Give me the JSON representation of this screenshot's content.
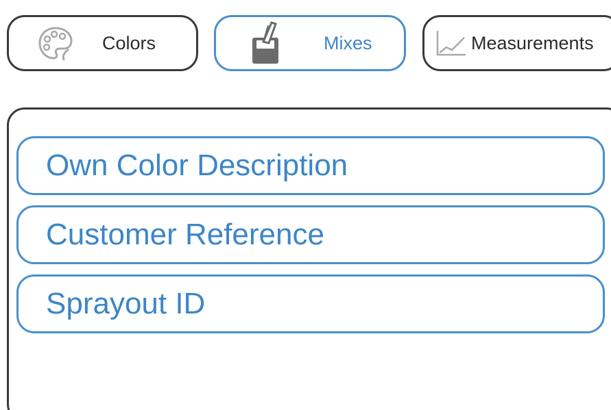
{
  "tabs": {
    "colors": {
      "label": "Colors",
      "icon": "palette-icon"
    },
    "mixes": {
      "label": "Mixes",
      "icon": "paint-can-icon",
      "active": true
    },
    "measurements": {
      "label": "Measurements",
      "icon": "line-chart-icon"
    }
  },
  "fields": {
    "own_color_description": "Own Color Description",
    "customer_reference": "Customer Reference",
    "sprayout_id": "Sprayout ID"
  },
  "colors": {
    "accent": "#4a8fc9",
    "accent_text": "#3d86c6",
    "border_dark": "#3a3a3a",
    "icon_gray": "#a9a9a9"
  }
}
